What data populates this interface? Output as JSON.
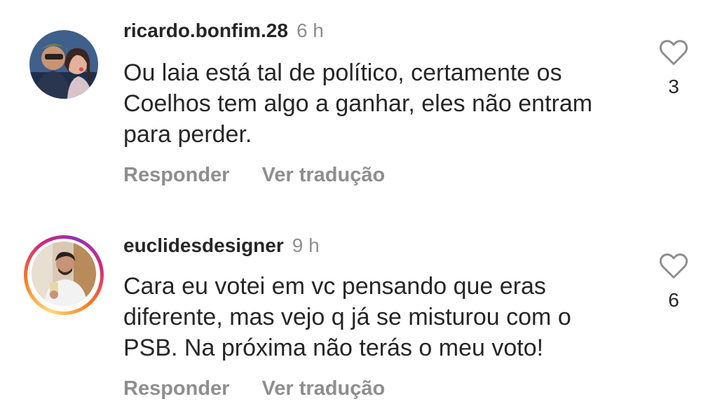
{
  "comments": [
    {
      "username": "ricardo.bonfim.28",
      "time": "6 h",
      "text": "Ou laia está tal de político, certamente os Coelhos tem algo a ganhar, eles não entram para perder.",
      "like_count": "3",
      "reply_label": "Responder",
      "translate_label": "Ver tradução",
      "avatar_icon": "profile-photo-couple",
      "has_story_ring": false
    },
    {
      "username": "euclidesdesigner",
      "time": "9 h",
      "text": "Cara eu votei em vc pensando que eras diferente, mas vejo q já se misturou com o PSB. Na próxima não terás o meu voto!",
      "like_count": "6",
      "reply_label": "Responder",
      "translate_label": "Ver tradução",
      "avatar_icon": "profile-photo-man-selfie",
      "has_story_ring": true
    }
  ],
  "icons": {
    "like": "heart-outline-icon"
  },
  "colors": {
    "text_primary": "#262626",
    "text_secondary": "#8e8e8e",
    "background": "#ffffff",
    "story_ring_start": "#feda75",
    "story_ring_mid": "#d62976",
    "story_ring_end": "#962fbf"
  }
}
